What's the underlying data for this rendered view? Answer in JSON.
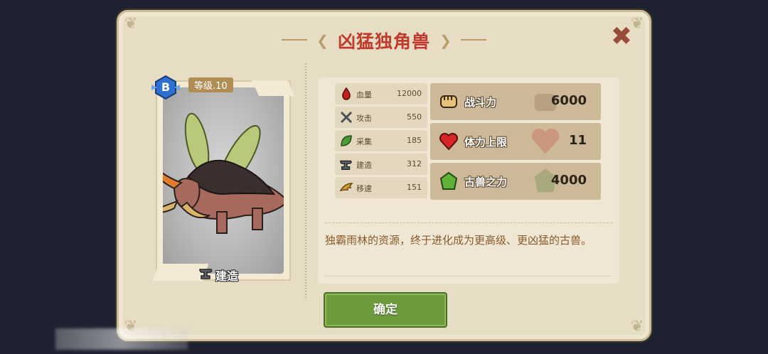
{
  "dialog": {
    "title": "凶猛独角兽",
    "close_icon": "close-x-icon",
    "confirm_label": "确定"
  },
  "card": {
    "grade": "B",
    "level": "等级.10",
    "type_label": "建造",
    "type_icon": "anvil-icon"
  },
  "stats": [
    {
      "icon": "blood-drop-icon",
      "label": "血量",
      "value": "12000"
    },
    {
      "icon": "crossed-swords-icon",
      "label": "攻击",
      "value": "550"
    },
    {
      "icon": "leaf-icon",
      "label": "采集",
      "value": "185"
    },
    {
      "icon": "anvil-icon",
      "label": "建造",
      "value": "312"
    },
    {
      "icon": "wing-icon",
      "label": "移速",
      "value": "151"
    }
  ],
  "big_stats": [
    {
      "icon": "fist-icon",
      "label": "战斗力",
      "value": "6000"
    },
    {
      "icon": "heart-icon",
      "label": "体力上限",
      "value": "11"
    },
    {
      "icon": "green-crystal-icon",
      "label": "古兽之力",
      "value": "4000"
    }
  ],
  "description": "独霸雨林的资源，终于进化成为更高级、更凶猛的古兽。",
  "colors": {
    "title": "#c0392b",
    "button": "#6d9a3a",
    "description": "#8a5a2c"
  }
}
